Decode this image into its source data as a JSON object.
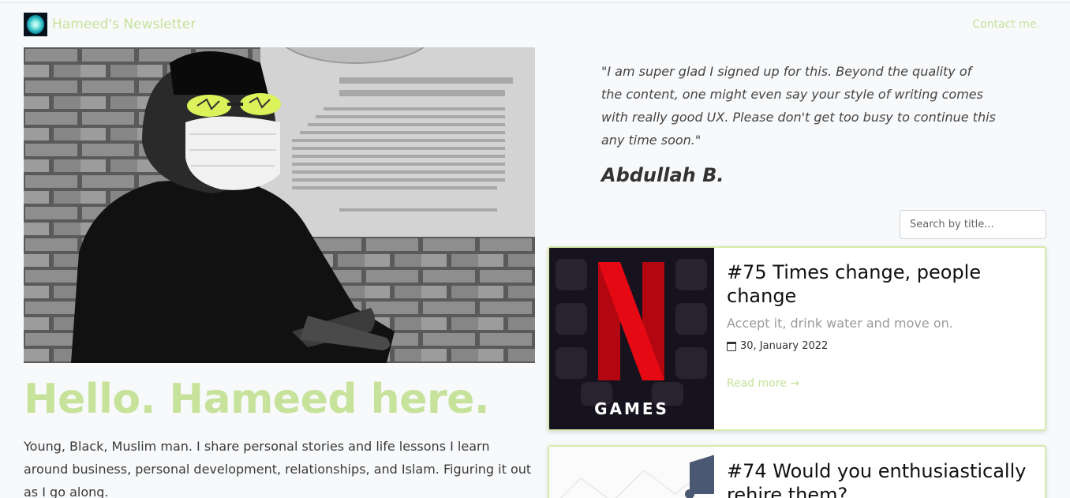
{
  "header": {
    "brand_name": "Hameed's Newsletter",
    "contact_label": "Contact me.",
    "logo_icon": "glowing-orb-logo"
  },
  "hero": {
    "photo_desc_icon": "profile-photo",
    "poster_lines": [
      "...ham International MBA Scholarship",
      "...or Change Catalysts in African Markets"
    ],
    "title": "Hello. Hameed here.",
    "intro": "Young, Black, Muslim man. I share personal stories and life lessons I learn around business, personal development, relationships, and Islam. Figuring it out as I go along."
  },
  "testimonial": {
    "quote": "\"I am super glad I signed up for this. Beyond the quality of the content, one might even say your style of writing comes with really good UX. Please don't get too busy to continue this any time soon.\"",
    "author": "Abdullah B."
  },
  "search": {
    "placeholder": "Search by title..."
  },
  "posts": [
    {
      "title": "#75 Times change, people change",
      "subtitle": "Accept it, drink water and move on.",
      "date": "30, January 2022",
      "read_more": "Read more →",
      "thumb_label": "GAMES"
    },
    {
      "title": "#74 Would you enthusiastically rehire them?"
    }
  ],
  "colors": {
    "accent": "#c7e29a",
    "netflix_red": "#e50914"
  }
}
